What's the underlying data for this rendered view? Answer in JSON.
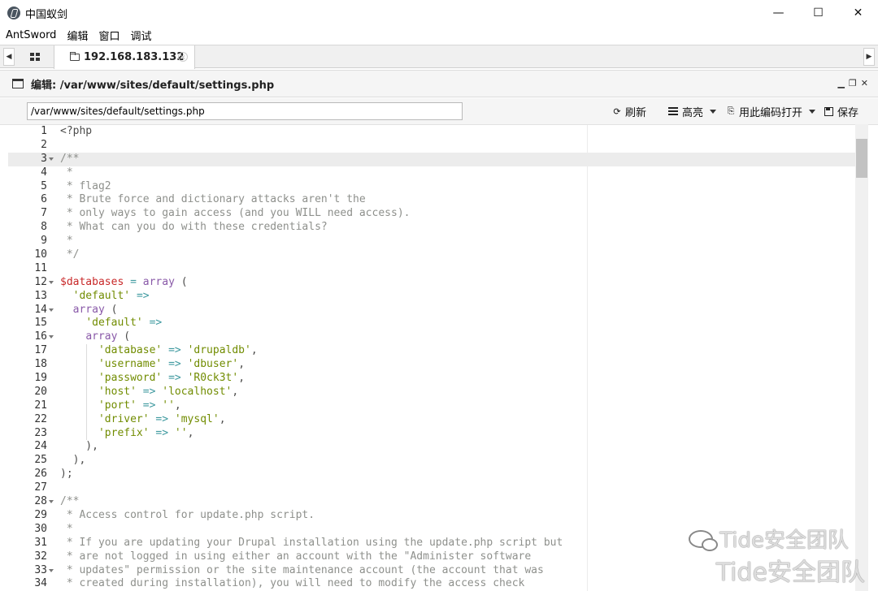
{
  "window": {
    "title": "中国蚁剑",
    "controls": {
      "minimize": "—",
      "maximize": "☐",
      "close": "✕"
    }
  },
  "menubar": {
    "items": [
      "AntSword",
      "编辑",
      "窗口",
      "调试"
    ]
  },
  "tabs": {
    "left_arrow": "◀",
    "right_arrow": "▶",
    "active_tab": {
      "label": "192.168.183.132",
      "close": "×"
    }
  },
  "editor": {
    "title": "编辑: /var/www/sites/default/settings.php",
    "controls": {
      "minimize": "▁",
      "restore": "❐",
      "close": "✕"
    },
    "path_value": "/var/www/sites/default/settings.php",
    "toolbar": {
      "refresh_label": "刷新",
      "highlight_label": "高亮",
      "encoding_label": "用此编码打开",
      "save_label": "保存"
    },
    "active_line": 3,
    "code_lines": [
      {
        "n": "1",
        "fold": false,
        "tokens": [
          [
            "plain",
            "<?php"
          ]
        ]
      },
      {
        "n": "2",
        "fold": false,
        "tokens": []
      },
      {
        "n": "3",
        "fold": true,
        "tokens": [
          [
            "comment",
            "/**"
          ]
        ]
      },
      {
        "n": "4",
        "fold": false,
        "tokens": [
          [
            "comment",
            " *"
          ]
        ]
      },
      {
        "n": "5",
        "fold": false,
        "tokens": [
          [
            "comment",
            " * flag2"
          ]
        ]
      },
      {
        "n": "6",
        "fold": false,
        "tokens": [
          [
            "comment",
            " * Brute force and dictionary attacks aren't the"
          ]
        ]
      },
      {
        "n": "7",
        "fold": false,
        "tokens": [
          [
            "comment",
            " * only ways to gain access (and you WILL need access)."
          ]
        ]
      },
      {
        "n": "8",
        "fold": false,
        "tokens": [
          [
            "comment",
            " * What can you do with these credentials?"
          ]
        ]
      },
      {
        "n": "9",
        "fold": false,
        "tokens": [
          [
            "comment",
            " *"
          ]
        ]
      },
      {
        "n": "10",
        "fold": false,
        "tokens": [
          [
            "comment",
            " */"
          ]
        ]
      },
      {
        "n": "11",
        "fold": false,
        "tokens": []
      },
      {
        "n": "12",
        "fold": true,
        "tokens": [
          [
            "var",
            "$databases"
          ],
          [
            "plain",
            " "
          ],
          [
            "op",
            "="
          ],
          [
            "plain",
            " "
          ],
          [
            "kw",
            "array"
          ],
          [
            "plain",
            " ("
          ]
        ]
      },
      {
        "n": "13",
        "fold": false,
        "tokens": [
          [
            "plain",
            "  "
          ],
          [
            "str",
            "'default'"
          ],
          [
            "plain",
            " "
          ],
          [
            "op",
            "=>"
          ]
        ]
      },
      {
        "n": "14",
        "fold": true,
        "tokens": [
          [
            "plain",
            "  "
          ],
          [
            "kw",
            "array"
          ],
          [
            "plain",
            " ("
          ]
        ]
      },
      {
        "n": "15",
        "fold": false,
        "tokens": [
          [
            "plain",
            "    "
          ],
          [
            "str",
            "'default'"
          ],
          [
            "plain",
            " "
          ],
          [
            "op",
            "=>"
          ]
        ]
      },
      {
        "n": "16",
        "fold": true,
        "tokens": [
          [
            "plain",
            "    "
          ],
          [
            "kw",
            "array"
          ],
          [
            "plain",
            " ("
          ]
        ]
      },
      {
        "n": "17",
        "fold": false,
        "tokens": [
          [
            "plain",
            "      "
          ],
          [
            "str",
            "'database'"
          ],
          [
            "plain",
            " "
          ],
          [
            "op",
            "=>"
          ],
          [
            "plain",
            " "
          ],
          [
            "str",
            "'drupaldb'"
          ],
          [
            "plain",
            ","
          ]
        ]
      },
      {
        "n": "18",
        "fold": false,
        "tokens": [
          [
            "plain",
            "      "
          ],
          [
            "str",
            "'username'"
          ],
          [
            "plain",
            " "
          ],
          [
            "op",
            "=>"
          ],
          [
            "plain",
            " "
          ],
          [
            "str",
            "'dbuser'"
          ],
          [
            "plain",
            ","
          ]
        ]
      },
      {
        "n": "19",
        "fold": false,
        "tokens": [
          [
            "plain",
            "      "
          ],
          [
            "str",
            "'password'"
          ],
          [
            "plain",
            " "
          ],
          [
            "op",
            "=>"
          ],
          [
            "plain",
            " "
          ],
          [
            "str",
            "'R0ck3t'"
          ],
          [
            "plain",
            ","
          ]
        ]
      },
      {
        "n": "20",
        "fold": false,
        "tokens": [
          [
            "plain",
            "      "
          ],
          [
            "str",
            "'host'"
          ],
          [
            "plain",
            " "
          ],
          [
            "op",
            "=>"
          ],
          [
            "plain",
            " "
          ],
          [
            "str",
            "'localhost'"
          ],
          [
            "plain",
            ","
          ]
        ]
      },
      {
        "n": "21",
        "fold": false,
        "tokens": [
          [
            "plain",
            "      "
          ],
          [
            "str",
            "'port'"
          ],
          [
            "plain",
            " "
          ],
          [
            "op",
            "=>"
          ],
          [
            "plain",
            " "
          ],
          [
            "str",
            "''"
          ],
          [
            "plain",
            ","
          ]
        ]
      },
      {
        "n": "22",
        "fold": false,
        "tokens": [
          [
            "plain",
            "      "
          ],
          [
            "str",
            "'driver'"
          ],
          [
            "plain",
            " "
          ],
          [
            "op",
            "=>"
          ],
          [
            "plain",
            " "
          ],
          [
            "str",
            "'mysql'"
          ],
          [
            "plain",
            ","
          ]
        ]
      },
      {
        "n": "23",
        "fold": false,
        "tokens": [
          [
            "plain",
            "      "
          ],
          [
            "str",
            "'prefix'"
          ],
          [
            "plain",
            " "
          ],
          [
            "op",
            "=>"
          ],
          [
            "plain",
            " "
          ],
          [
            "str",
            "''"
          ],
          [
            "plain",
            ","
          ]
        ]
      },
      {
        "n": "24",
        "fold": false,
        "tokens": [
          [
            "plain",
            "    ),"
          ]
        ]
      },
      {
        "n": "25",
        "fold": false,
        "tokens": [
          [
            "plain",
            "  ),"
          ]
        ]
      },
      {
        "n": "26",
        "fold": false,
        "tokens": [
          [
            "plain",
            ");"
          ]
        ]
      },
      {
        "n": "27",
        "fold": false,
        "tokens": []
      },
      {
        "n": "28",
        "fold": true,
        "tokens": [
          [
            "comment",
            "/**"
          ]
        ]
      },
      {
        "n": "29",
        "fold": false,
        "tokens": [
          [
            "comment",
            " * Access control for update.php script."
          ]
        ]
      },
      {
        "n": "30",
        "fold": false,
        "tokens": [
          [
            "comment",
            " *"
          ]
        ]
      },
      {
        "n": "31",
        "fold": false,
        "tokens": [
          [
            "comment",
            " * If you are updating your Drupal installation using the update.php script but"
          ]
        ]
      },
      {
        "n": "32",
        "fold": false,
        "tokens": [
          [
            "comment",
            " * are not logged in using either an account with the \"Administer software"
          ]
        ]
      },
      {
        "n": "33",
        "fold": true,
        "tokens": [
          [
            "comment",
            " * updates\" permission or the site maintenance account (the account that was"
          ]
        ]
      },
      {
        "n": "34",
        "fold": false,
        "tokens": [
          [
            "comment",
            " * created during installation), you will need to modify the access check"
          ]
        ]
      }
    ]
  },
  "watermark": {
    "line1": "Tide安全团队",
    "line2": "Tide安全团队"
  }
}
